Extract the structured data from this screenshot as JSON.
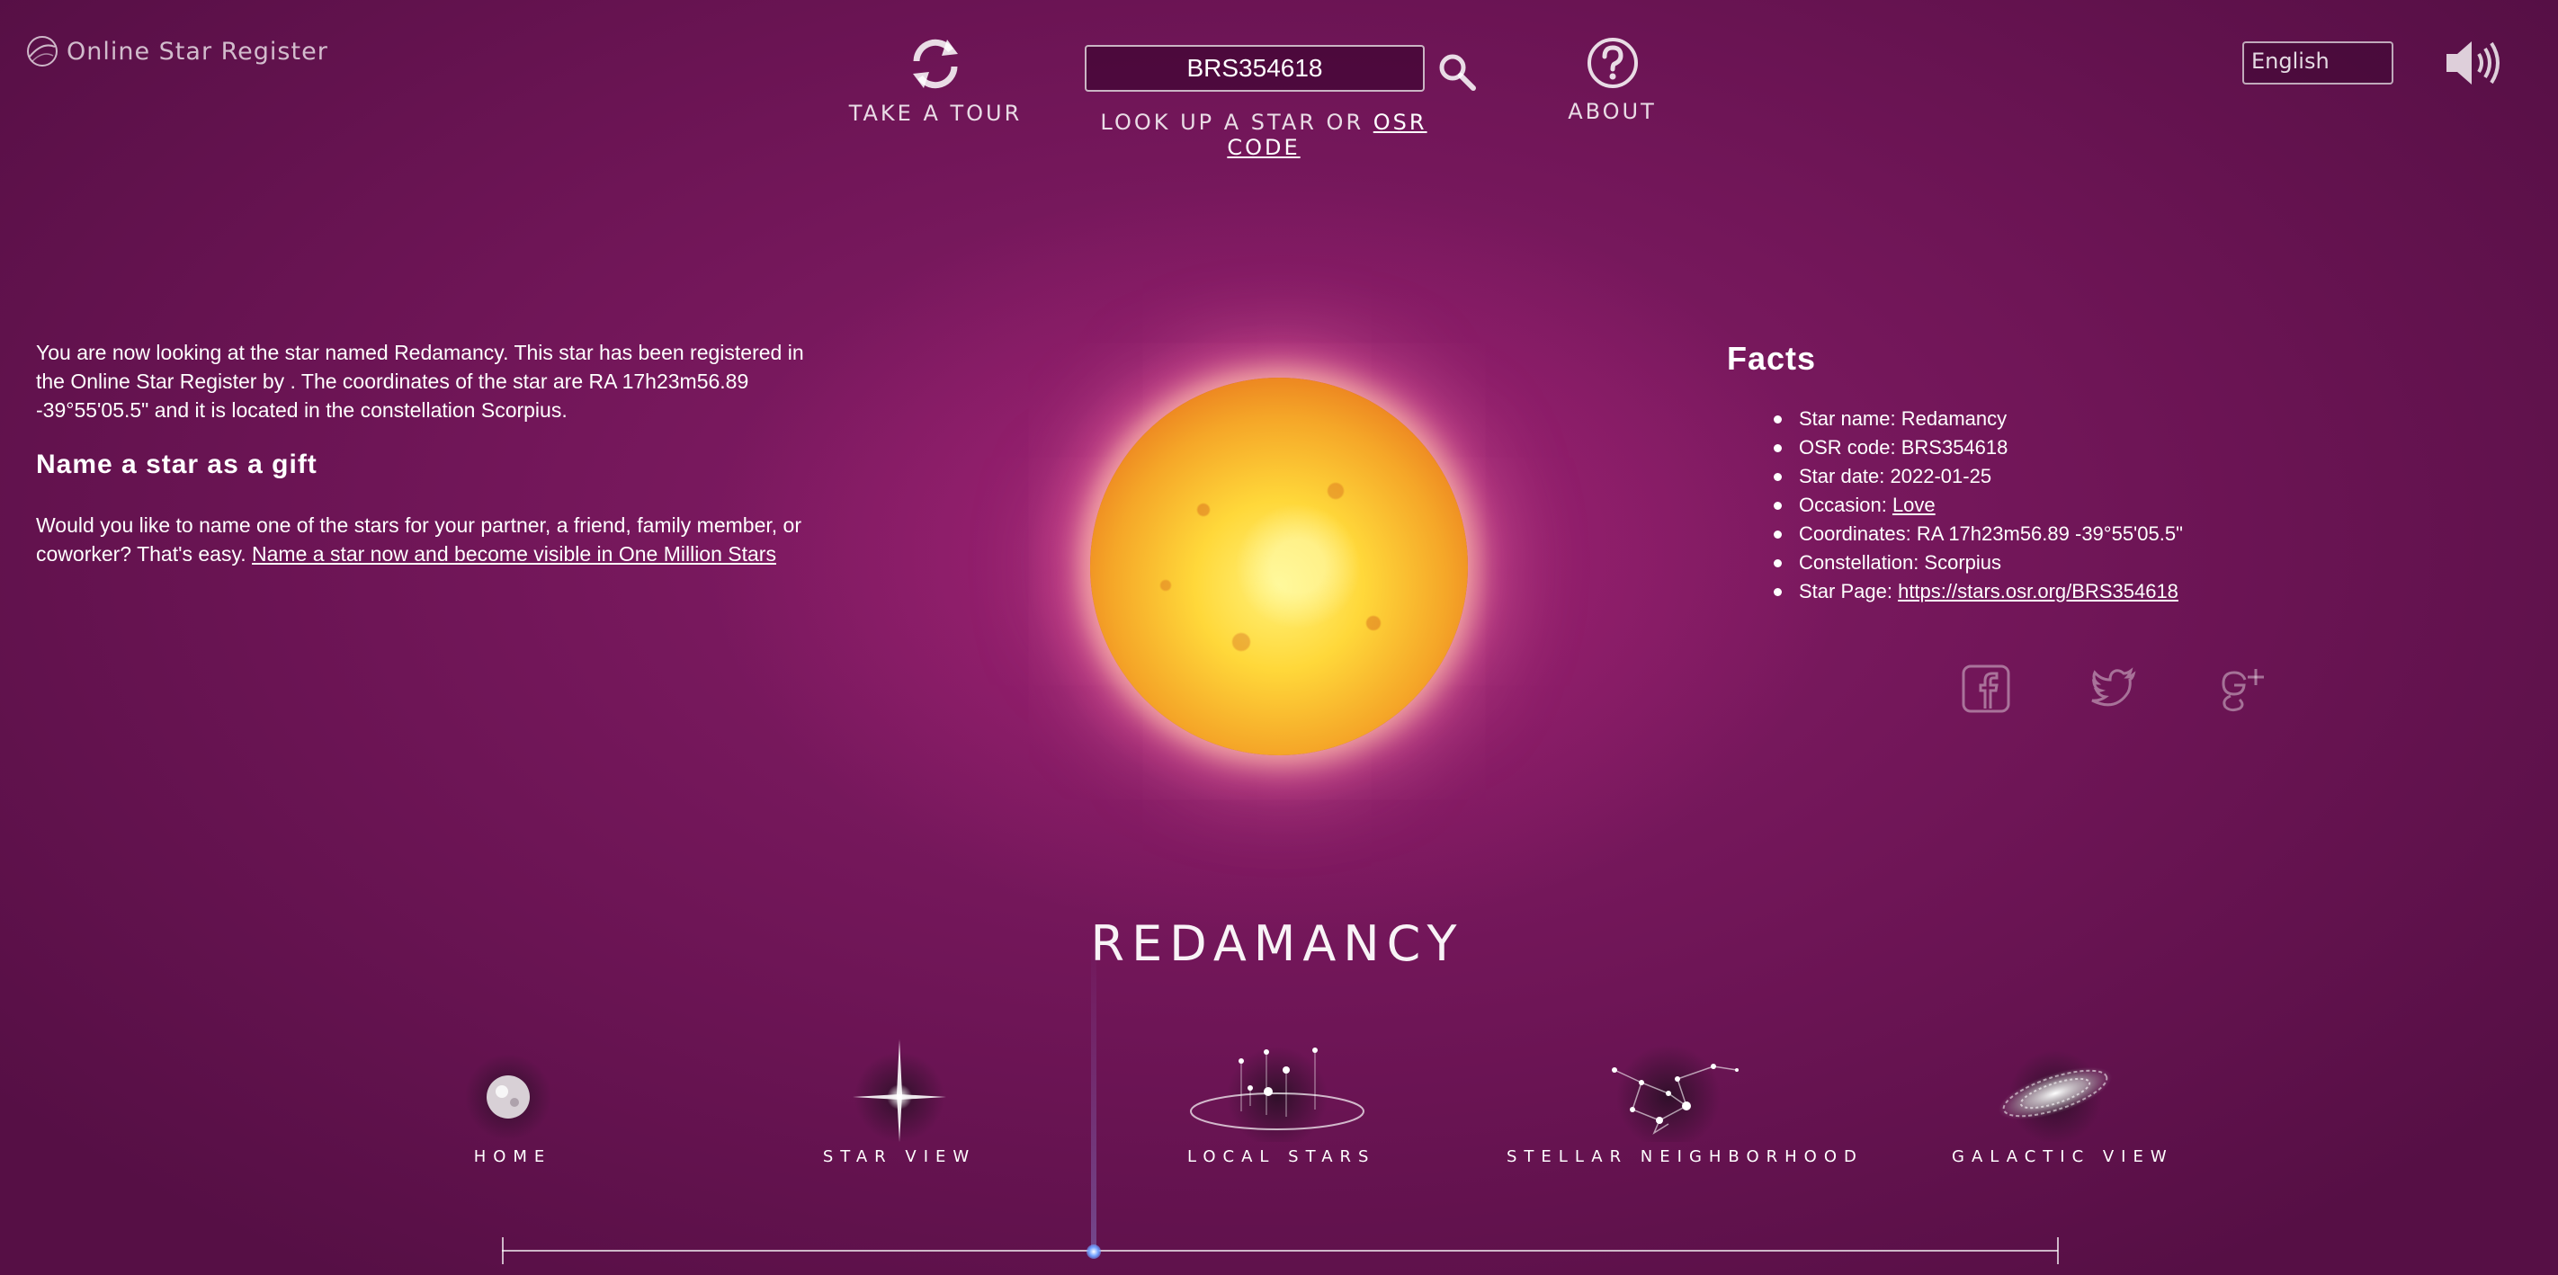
{
  "app": {
    "logo_text": "Online Star Register"
  },
  "topnav": {
    "tour_label": "TAKE A TOUR",
    "lookup_prefix": "LOOK UP A STAR OR ",
    "lookup_link": "OSR CODE",
    "about_label": "ABOUT",
    "search_value": "BRS354618",
    "language": "English",
    "icons": [
      "refresh-icon",
      "search-icon",
      "help-icon",
      "speaker-icon"
    ]
  },
  "intro": {
    "text": "You are now looking at the star named Redamancy. This star has been registered in the Online Star Register by . The coordinates of the star are RA 17h23m56.89 -39°55'05.5\" and it is located in the constellation Scorpius.",
    "gift_title": "Name a star as a gift",
    "gift_text": "Would you like to name one of the stars for your partner, a friend, family member, or coworker? That's easy. ",
    "gift_link": "Name a star now and become visible in One Million Stars"
  },
  "facts": {
    "title": "Facts",
    "items": [
      {
        "label": "Star name: ",
        "value": "Redamancy"
      },
      {
        "label": "OSR code: ",
        "value": "BRS354618"
      },
      {
        "label": "Star date: ",
        "value": "2022-01-25"
      },
      {
        "label": "Occasion: ",
        "value": "Love",
        "link": true
      },
      {
        "label": "Coordinates: ",
        "value": "RA 17h23m56.89 -39°55'05.5\""
      },
      {
        "label": "Constellation: ",
        "value": "Scorpius"
      },
      {
        "label": "Star Page: ",
        "value": "https://stars.osr.org/BRS354618",
        "link": true
      }
    ],
    "social": [
      "facebook-icon",
      "twitter-icon",
      "google-plus-icon"
    ]
  },
  "star": {
    "name": "REDAMANCY"
  },
  "bottomnav": {
    "items": [
      {
        "label": "HOME"
      },
      {
        "label": "STAR VIEW"
      },
      {
        "label": "LOCAL STARS"
      },
      {
        "label": "STELLAR NEIGHBORHOOD"
      },
      {
        "label": "GALACTIC VIEW"
      }
    ]
  }
}
